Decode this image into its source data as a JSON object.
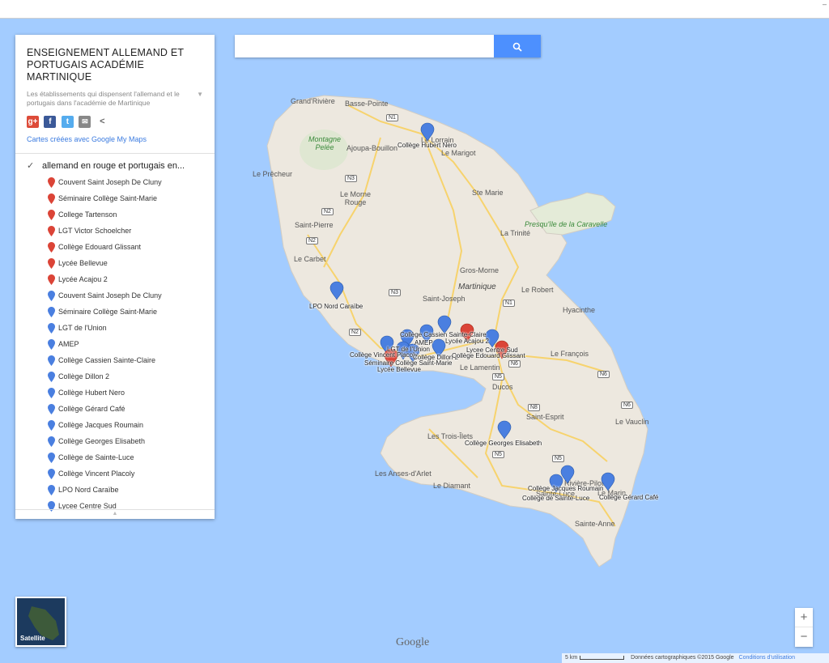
{
  "panel": {
    "title": "ENSEIGNEMENT ALLEMAND ET PORTUGAIS ACADÉMIE MARTINIQUE",
    "description": "Les établissements qui dispensent l'allemand et le portugais dans l'académie de Martinique",
    "credit": "Cartes créées avec Google My Maps",
    "layer_title": "allemand en rouge et portugais en...",
    "social_icons": [
      "google-plus-icon",
      "facebook-icon",
      "twitter-icon",
      "email-icon",
      "share-icon"
    ],
    "items": [
      {
        "label": "Couvent Saint Joseph De Cluny",
        "color": "#db4437"
      },
      {
        "label": "Séminaire Collège Saint-Marie",
        "color": "#db4437"
      },
      {
        "label": "College Tartenson",
        "color": "#db4437"
      },
      {
        "label": "LGT Victor Schoelcher",
        "color": "#db4437"
      },
      {
        "label": "Collège Edouard Glissant",
        "color": "#db4437"
      },
      {
        "label": "Lycée Bellevue",
        "color": "#db4437"
      },
      {
        "label": "Lycée Acajou 2",
        "color": "#db4437"
      },
      {
        "label": "Couvent Saint Joseph De Cluny",
        "color": "#4a7fe0"
      },
      {
        "label": "Séminaire Collège Saint-Marie",
        "color": "#4a7fe0"
      },
      {
        "label": "LGT de l'Union",
        "color": "#4a7fe0"
      },
      {
        "label": "AMEP",
        "color": "#4a7fe0"
      },
      {
        "label": "Collège Cassien Sainte-Claire",
        "color": "#4a7fe0"
      },
      {
        "label": "Collège Dillon 2",
        "color": "#4a7fe0"
      },
      {
        "label": "Collège Hubert Nero",
        "color": "#4a7fe0"
      },
      {
        "label": "Collège Gérard Café",
        "color": "#4a7fe0"
      },
      {
        "label": "Collège Jacques Roumain",
        "color": "#4a7fe0"
      },
      {
        "label": "Collège Georges Elisabeth",
        "color": "#4a7fe0"
      },
      {
        "label": "Collège de Sainte-Luce",
        "color": "#4a7fe0"
      },
      {
        "label": "Collège Vincent Placoly",
        "color": "#4a7fe0"
      },
      {
        "label": "LPO Nord Caraïbe",
        "color": "#4a7fe0"
      },
      {
        "label": "Lycee Centre Sud",
        "color": "#4a7fe0"
      }
    ]
  },
  "search": {
    "placeholder": "",
    "button_icon": "search-icon"
  },
  "map": {
    "places": {
      "grand_riviere": "Grand'Rivière",
      "basse_pointe": "Basse-Pointe",
      "lorrain": "Le Lorrain",
      "marigot": "Le Marigot",
      "montagne_pelee": "Montagne Pelée",
      "ajoupa": "Ajoupa-Bouillon",
      "precheur": "Le Prêcheur",
      "morne_rouge": "Le Morne Rouge",
      "ste_marie": "Ste Marie",
      "saint_pierre": "Saint-Pierre",
      "presquile": "Presqu'île de la Caravelle",
      "trinite": "La Trinité",
      "carbet": "Le Carbet",
      "gros_morne": "Gros-Morne",
      "martinique": "Martinique",
      "robert": "Le Robert",
      "saint_joseph": "Saint-Joseph",
      "hyacinthe": "Hyacinthe",
      "francois": "Le François",
      "lamentin": "Le Lamentin",
      "ducos": "Ducos",
      "saint_esprit": "Saint-Esprit",
      "vauclin": "Le Vauclin",
      "trois_ilets": "Les Trois-Îlets",
      "anses_arlet": "Les Anses-d'Arlet",
      "diamant": "Le Diamant",
      "riviere_pilote": "Rivière-Pilote",
      "sainte_luce": "Sainte-Luce",
      "marin": "Le Marin",
      "sainte_anne": "Sainte-Anne"
    },
    "roads": [
      "N1",
      "N3",
      "N2",
      "N2",
      "N3",
      "N1",
      "N2",
      "N5",
      "N6",
      "N6",
      "N6",
      "N8",
      "N5",
      "N5"
    ],
    "marker_labels": {
      "hubert_nero": "Collège Hubert Nero",
      "lpo_nord": "LPO Nord Caraïbe",
      "cassien": "Collège Cassien Sainte-Claire",
      "acajou": "Lycée Acajou 2",
      "amep": "AMEP",
      "lgt_union": "LGT de l'Union",
      "centre_sud": "Lycee Centre Sud",
      "vincent_placoly": "Collège Vincent Placoly",
      "dillon": "Collège Dillon 2",
      "edouard": "Collège Edouard Glissant",
      "seminaire": "Séminaire Collège Saint-Marie",
      "bellevue": "Lycée Bellevue",
      "georges": "Collège Georges Elisabeth",
      "jacques": "Collège Jacques Roumain",
      "sainte_luce": "Collège de Sainte-Luce",
      "gerard": "Collège Gérard Café"
    }
  },
  "satellite_label": "Satellite",
  "zoom": {
    "in": "+",
    "out": "−"
  },
  "google_logo": "Google",
  "attribution": {
    "scale": "5 km",
    "data": "Données cartographiques ©2015 Google",
    "terms": "Conditions d'utilisation"
  }
}
